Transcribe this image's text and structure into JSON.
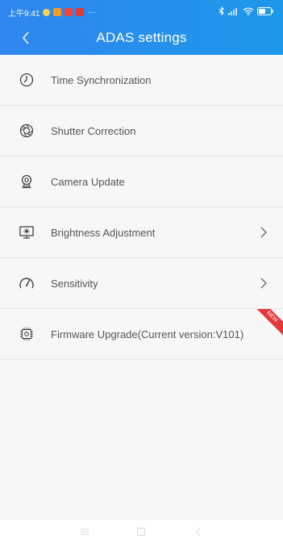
{
  "status_bar": {
    "time": "上午9:41",
    "dots": "···",
    "app_colors": [
      "#f59a1b",
      "#f44336",
      "#e53935"
    ]
  },
  "header": {
    "title": "ADAS settings",
    "back_icon": "chevron-left-icon",
    "gradient": [
      "#2f86ee",
      "#1e98ea"
    ]
  },
  "menu": {
    "items": [
      {
        "label": "Time Synchronization",
        "icon": "clock-icon",
        "chevron": false
      },
      {
        "label": "Shutter Correction",
        "icon": "shutter-icon",
        "chevron": false
      },
      {
        "label": "Camera Update",
        "icon": "webcam-icon",
        "chevron": false
      },
      {
        "label": "Brightness Adjustment",
        "icon": "brightness-monitor-icon",
        "chevron": true
      },
      {
        "label": "Sensitivity",
        "icon": "gauge-icon",
        "chevron": true
      },
      {
        "label": "Firmware Upgrade(Current version:V101)",
        "icon": "gear-chip-icon",
        "chevron": false,
        "badge": "NEW"
      }
    ]
  },
  "colors": {
    "accent": "#1e88e5",
    "badge": "#e23a3a",
    "text": "#555555",
    "divider": "#e3e3e3",
    "background": "#f7f7f7"
  }
}
